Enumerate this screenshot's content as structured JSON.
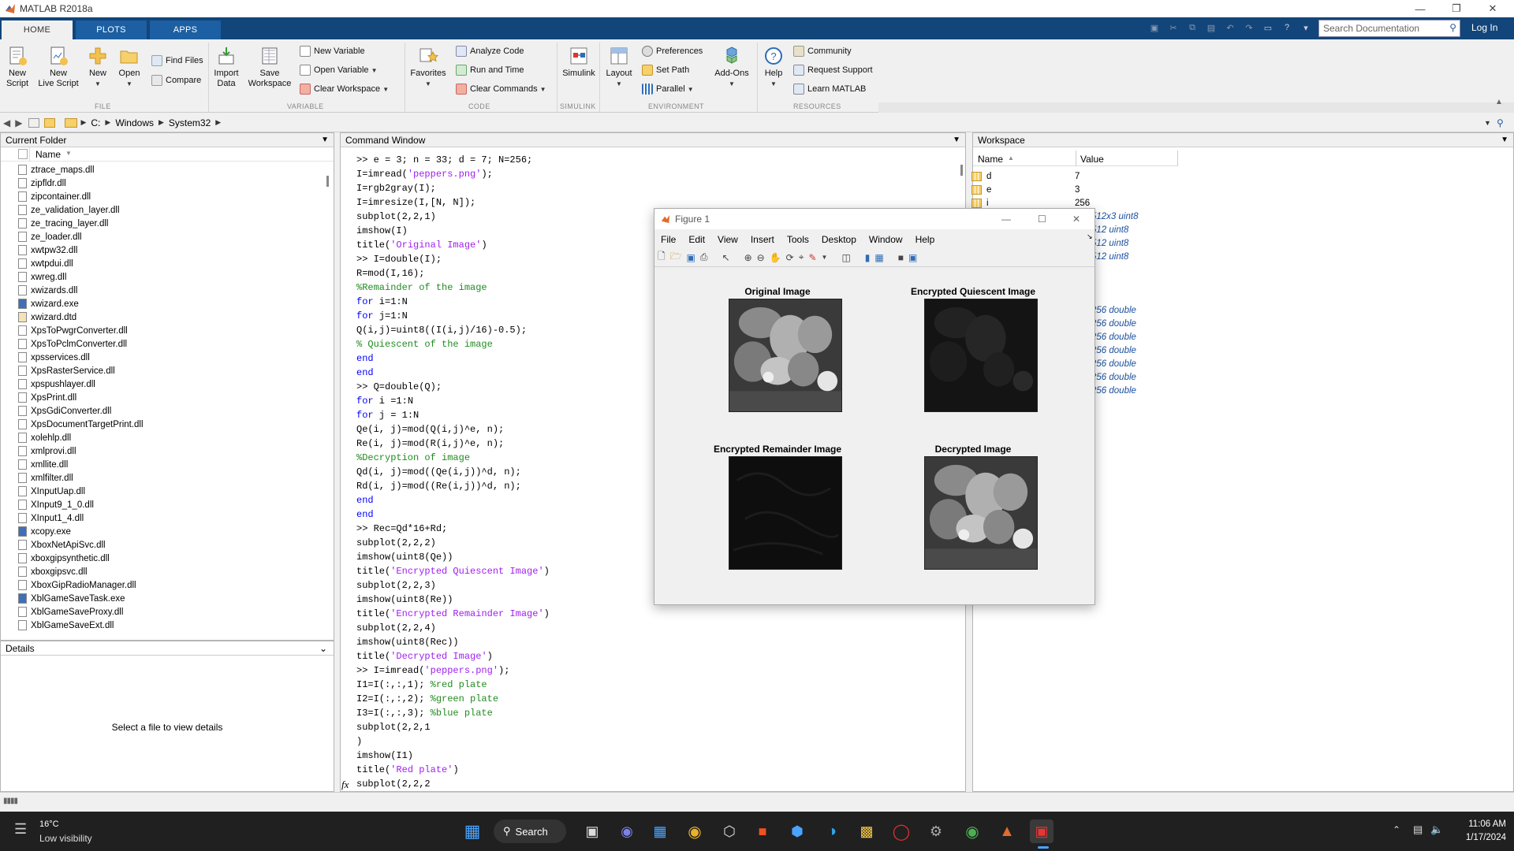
{
  "app": {
    "title": "MATLAB R2018a"
  },
  "tabs": [
    "HOME",
    "PLOTS",
    "APPS"
  ],
  "search": {
    "placeholder": "Search Documentation"
  },
  "login": "Log In",
  "ribbon": {
    "file": {
      "new_script": [
        "New",
        "Script"
      ],
      "new_live_script": [
        "New",
        "Live Script"
      ],
      "new": "New",
      "open": "Open",
      "find_files": "Find Files",
      "compare": "Compare",
      "label": "FILE"
    },
    "variable": {
      "import_data": [
        "Import",
        "Data"
      ],
      "save_workspace": [
        "Save",
        "Workspace"
      ],
      "new_variable": "New Variable",
      "open_variable": "Open Variable",
      "clear_workspace": "Clear Workspace",
      "label": "VARIABLE"
    },
    "code": {
      "favorites": "Favorites",
      "analyze_code": "Analyze Code",
      "run_and_time": "Run and Time",
      "clear_commands": "Clear Commands",
      "label": "CODE"
    },
    "simulink": {
      "simulink": "Simulink",
      "label": "SIMULINK"
    },
    "environment": {
      "layout": "Layout",
      "preferences": "Preferences",
      "set_path": "Set Path",
      "parallel": "Parallel",
      "add_ons": "Add-Ons",
      "label": "ENVIRONMENT"
    },
    "resources": {
      "help": "Help",
      "community": "Community",
      "request_support": "Request Support",
      "learn_matlab": "Learn MATLAB",
      "label": "RESOURCES"
    }
  },
  "address": {
    "path": [
      "C:",
      "Windows",
      "System32"
    ]
  },
  "current_folder": {
    "title": "Current Folder",
    "column": "Name",
    "files": [
      "ztrace_maps.dll",
      "zipfldr.dll",
      "zipcontainer.dll",
      "ze_validation_layer.dll",
      "ze_tracing_layer.dll",
      "ze_loader.dll",
      "xwtpw32.dll",
      "xwtpdui.dll",
      "xwreg.dll",
      "xwizards.dll",
      "xwizard.exe",
      "xwizard.dtd",
      "XpsToPwgrConverter.dll",
      "XpsToPclmConverter.dll",
      "xpsservices.dll",
      "XpsRasterService.dll",
      "xpspushlayer.dll",
      "XpsPrint.dll",
      "XpsGdiConverter.dll",
      "XpsDocumentTargetPrint.dll",
      "xolehlp.dll",
      "xmlprovi.dll",
      "xmllite.dll",
      "xmlfilter.dll",
      "XInputUap.dll",
      "XInput9_1_0.dll",
      "XInput1_4.dll",
      "xcopy.exe",
      "XboxNetApiSvc.dll",
      "xboxgipsynthetic.dll",
      "xboxgipsvc.dll",
      "XboxGipRadioManager.dll",
      "XblGameSaveTask.exe",
      "XblGameSaveProxy.dll",
      "XblGameSaveExt.dll"
    ]
  },
  "details": {
    "title": "Details",
    "message": "Select a file to view details"
  },
  "command_window": {
    "title": "Command Window",
    "lines": [
      [
        [
          "p",
          ">> e = 3; n = 33; d = 7; N=256;"
        ]
      ],
      [
        [
          "p",
          "I=imread("
        ],
        [
          "s",
          "'peppers.png'"
        ],
        [
          "p",
          ");"
        ]
      ],
      [
        [
          "p",
          "I=rgb2gray(I);"
        ]
      ],
      [
        [
          "p",
          "I=imresize(I,[N, N]);"
        ]
      ],
      [
        [
          "p",
          "subplot(2,2,1)"
        ]
      ],
      [
        [
          "p",
          "imshow(I)"
        ]
      ],
      [
        [
          "p",
          "title("
        ],
        [
          "s",
          "'Original Image'"
        ],
        [
          "p",
          ")"
        ]
      ],
      [
        [
          "p",
          ">> I=double(I);"
        ]
      ],
      [
        [
          "p",
          "R=mod(I,16);"
        ]
      ],
      [
        [
          "c",
          "%Remainder of the image"
        ]
      ],
      [
        [
          "k",
          "for"
        ],
        [
          "p",
          " i=1:N"
        ]
      ],
      [
        [
          "k",
          "for"
        ],
        [
          "p",
          " j=1:N"
        ]
      ],
      [
        [
          "p",
          "Q(i,j)=uint8((I(i,j)/16)-0.5);"
        ]
      ],
      [
        [
          "c",
          "% Quiescent of the image"
        ]
      ],
      [
        [
          "k",
          "end"
        ]
      ],
      [
        [
          "k",
          "end"
        ]
      ],
      [
        [
          "p",
          ">> Q=double(Q);"
        ]
      ],
      [
        [
          "k",
          "for"
        ],
        [
          "p",
          " i =1:N"
        ]
      ],
      [
        [
          "k",
          "for"
        ],
        [
          "p",
          " j = 1:N"
        ]
      ],
      [
        [
          "p",
          "Qe(i, j)=mod(Q(i,j)^e, n);"
        ]
      ],
      [
        [
          "p",
          "Re(i, j)=mod(R(i,j)^e, n);"
        ]
      ],
      [
        [
          "c",
          "%Decryption of image"
        ]
      ],
      [
        [
          "p",
          "Qd(i, j)=mod((Qe(i,j))^d, n);"
        ]
      ],
      [
        [
          "p",
          "Rd(i, j)=mod((Re(i,j))^d, n);"
        ]
      ],
      [
        [
          "k",
          "end"
        ]
      ],
      [
        [
          "k",
          "end"
        ]
      ],
      [
        [
          "p",
          ">> Rec=Qd*16+Rd;"
        ]
      ],
      [
        [
          "p",
          "subplot(2,2,2)"
        ]
      ],
      [
        [
          "p",
          "imshow(uint8(Qe))"
        ]
      ],
      [
        [
          "p",
          "title("
        ],
        [
          "s",
          "'Encrypted Quiescent Image'"
        ],
        [
          "p",
          ")"
        ]
      ],
      [
        [
          "p",
          "subplot(2,2,3)"
        ]
      ],
      [
        [
          "p",
          "imshow(uint8(Re))"
        ]
      ],
      [
        [
          "p",
          "title("
        ],
        [
          "s",
          "'Encrypted Remainder Image'"
        ],
        [
          "p",
          ")"
        ]
      ],
      [
        [
          "p",
          "subplot(2,2,4)"
        ]
      ],
      [
        [
          "p",
          "imshow(uint8(Rec))"
        ]
      ],
      [
        [
          "p",
          "title("
        ],
        [
          "s",
          "'Decrypted Image'"
        ],
        [
          "p",
          ")"
        ]
      ],
      [
        [
          "p",
          ">> I=imread("
        ],
        [
          "s",
          "'peppers.png'"
        ],
        [
          "p",
          ");"
        ]
      ],
      [
        [
          "p",
          "I1=I(:,:,1); "
        ],
        [
          "c",
          "%red plate"
        ]
      ],
      [
        [
          "p",
          "I2=I(:,:,2); "
        ],
        [
          "c",
          "%green plate"
        ]
      ],
      [
        [
          "p",
          "I3=I(:,:,3); "
        ],
        [
          "c",
          "%blue plate"
        ]
      ],
      [
        [
          "p",
          "subplot(2,2,1"
        ]
      ],
      [
        [
          "p",
          ")"
        ]
      ],
      [
        [
          "p",
          "imshow(I1)"
        ]
      ],
      [
        [
          "p",
          "title("
        ],
        [
          "s",
          "'Red plate'"
        ],
        [
          "p",
          ")"
        ]
      ],
      [
        [
          "p",
          "subplot(2,2,2"
        ]
      ]
    ],
    "fx": "fx"
  },
  "workspace": {
    "title": "Workspace",
    "col_name": "Name",
    "col_value": "Value",
    "rows": [
      {
        "name": "d",
        "value": "7"
      },
      {
        "name": "e",
        "value": "3"
      },
      {
        "name": "i",
        "value": "256"
      }
    ],
    "hidden_values": [
      "512x3 uint8",
      "512 uint8",
      "512 uint8",
      "512 uint8",
      "256 double",
      "256 double",
      "256 double",
      "256 double",
      "256 double",
      "256 double",
      "256 double"
    ]
  },
  "figure": {
    "title": "Figure 1",
    "menu": [
      "File",
      "Edit",
      "View",
      "Insert",
      "Tools",
      "Desktop",
      "Window",
      "Help"
    ],
    "subplots": [
      "Original Image",
      "Encrypted Quiescent Image",
      "Encrypted Remainder Image",
      "Decrypted Image"
    ]
  },
  "taskbar": {
    "weather_temp": "16°C",
    "weather_desc": "Low visibility",
    "search": "Search",
    "time": "11:06 AM",
    "date": "1/17/2024"
  }
}
